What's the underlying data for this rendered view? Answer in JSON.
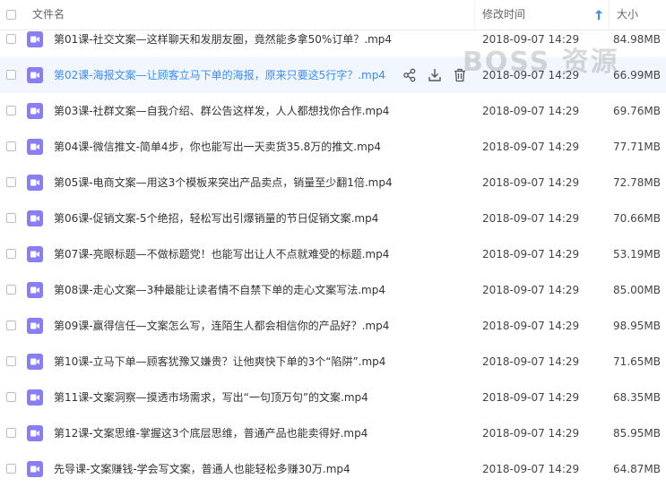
{
  "header": {
    "name_label": "文件名",
    "time_label": "修改时间",
    "size_label": "大小"
  },
  "watermark": "BOSS 资源",
  "files": [
    {
      "name": "第01课-社交文案—这样聊天和发朋友圈，竟然能多拿50%订单？.mp4",
      "time": "2018-09-07 14:29",
      "size": "84.98MB"
    },
    {
      "name": "第02课-海报文案—让顾客立马下单的海报，原来只要这5行字？.mp4",
      "time": "2018-09-07 14:29",
      "size": "66.99MB"
    },
    {
      "name": "第03课-社群文案—自我介绍、群公告这样发，人人都想找你合作.mp4",
      "time": "2018-09-07 14:29",
      "size": "69.76MB"
    },
    {
      "name": "第04课-微信推文-简单4步，你也能写出一天卖货35.8万的推文.mp4",
      "time": "2018-09-07 14:29",
      "size": "77.71MB"
    },
    {
      "name": "第05课-电商文案—用这3个模板来突出产品卖点，销量至少翻1倍.mp4",
      "time": "2018-09-07 14:29",
      "size": "72.78MB"
    },
    {
      "name": "第06课-促销文案-5个绝招，轻松写出引爆销量的节日促销文案.mp4",
      "time": "2018-09-07 14:29",
      "size": "70.66MB"
    },
    {
      "name": "第07课-亮眼标题—不做标题党！也能写出让人不点就难受的标题.mp4",
      "time": "2018-09-07 14:29",
      "size": "53.19MB"
    },
    {
      "name": "第08课-走心文案—3种最能让读者情不自禁下单的走心文案写法.mp4",
      "time": "2018-09-07 14:29",
      "size": "85.00MB"
    },
    {
      "name": "第09课-赢得信任—文案怎么写，连陌生人都会相信你的产品好？.mp4",
      "time": "2018-09-07 14:29",
      "size": "98.95MB"
    },
    {
      "name": "第10课-立马下单—顾客犹豫又嫌贵？让他爽快下单的3个“陷阱”.mp4",
      "time": "2018-09-07 14:29",
      "size": "71.65MB"
    },
    {
      "name": "第11课-文案洞察—摸透市场需求，写出“一句顶万句”的文案.mp4",
      "time": "2018-09-07 14:29",
      "size": "68.35MB"
    },
    {
      "name": "第12课-文案思维-掌握这3个底层思维，普通产品也能卖得好.mp4",
      "time": "2018-09-07 14:29",
      "size": "85.95MB"
    },
    {
      "name": "先导课-文案赚钱-学会写文案，普通人也能轻松多赚30万.mp4",
      "time": "2018-09-07 14:29",
      "size": "64.87MB"
    }
  ]
}
